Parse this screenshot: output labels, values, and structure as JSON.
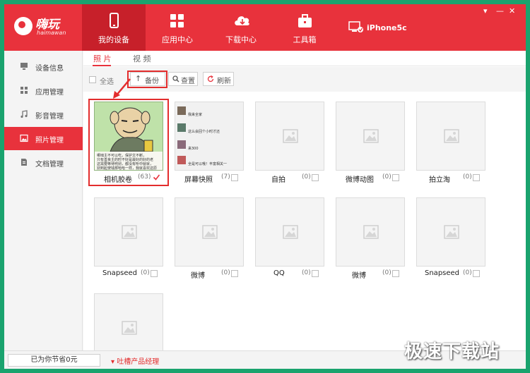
{
  "app": {
    "logo_name": "嗨玩",
    "logo_sub": "haimawan",
    "nav": [
      {
        "label": "我的设备",
        "icon": "phone-icon"
      },
      {
        "label": "应用中心",
        "icon": "apps-grid-icon"
      },
      {
        "label": "下载中心",
        "icon": "cloud-download-icon"
      },
      {
        "label": "工具箱",
        "icon": "toolbox-icon"
      }
    ],
    "device_name": "iPhone5c",
    "window_controls": [
      "▾",
      "—",
      "✕"
    ]
  },
  "sidebar": {
    "items": [
      {
        "label": "设备信息",
        "icon": "monitor-icon"
      },
      {
        "label": "应用管理",
        "icon": "apps-icon"
      },
      {
        "label": "影音管理",
        "icon": "music-note-icon"
      },
      {
        "label": "照片管理",
        "icon": "image-icon"
      },
      {
        "label": "文档管理",
        "icon": "document-icon"
      }
    ],
    "active_index": 3
  },
  "tabs": [
    "照 片",
    "视 频"
  ],
  "toolbar": {
    "select_all": "全选",
    "backup": "备份",
    "view": "查置",
    "refresh": "刷新"
  },
  "albums": [
    {
      "name": "相机胶卷",
      "count": "(63)",
      "checked": true
    },
    {
      "name": "屏幕快照",
      "count": "(7)"
    },
    {
      "name": "自拍",
      "count": "(0)"
    },
    {
      "name": "微博动图",
      "count": "(0)"
    },
    {
      "name": "拍立淘",
      "count": "(0)"
    },
    {
      "name": "Snapseed",
      "count": "(0)"
    },
    {
      "name": "微博",
      "count": "(0)"
    },
    {
      "name": "QQ",
      "count": "(0)"
    },
    {
      "name": "微博",
      "count": "(0)"
    },
    {
      "name": "Snapseed",
      "count": "(0)"
    },
    {
      "name": "",
      "count": ""
    }
  ],
  "meme_text": [
    "哪咄主不可以吃，保护文不断，",
    "只有善良主的时不好是最好的好的老",
    "这需要等待哟别，都没有听中就就，",
    "别到起使钱那哈哈一样，我就喜欢这原"
  ],
  "chat_lines": [
    "我来全家",
    "这么会回个小时才还",
    "来300",
    "全是可以哦！丰富相关一"
  ],
  "footer": {
    "savings": "已为你节省0元",
    "feedback": "吐槽产品经理"
  },
  "watermark": "极速下载站",
  "colors": {
    "brand": "#e8323c",
    "highlight": "#e32d2d"
  }
}
